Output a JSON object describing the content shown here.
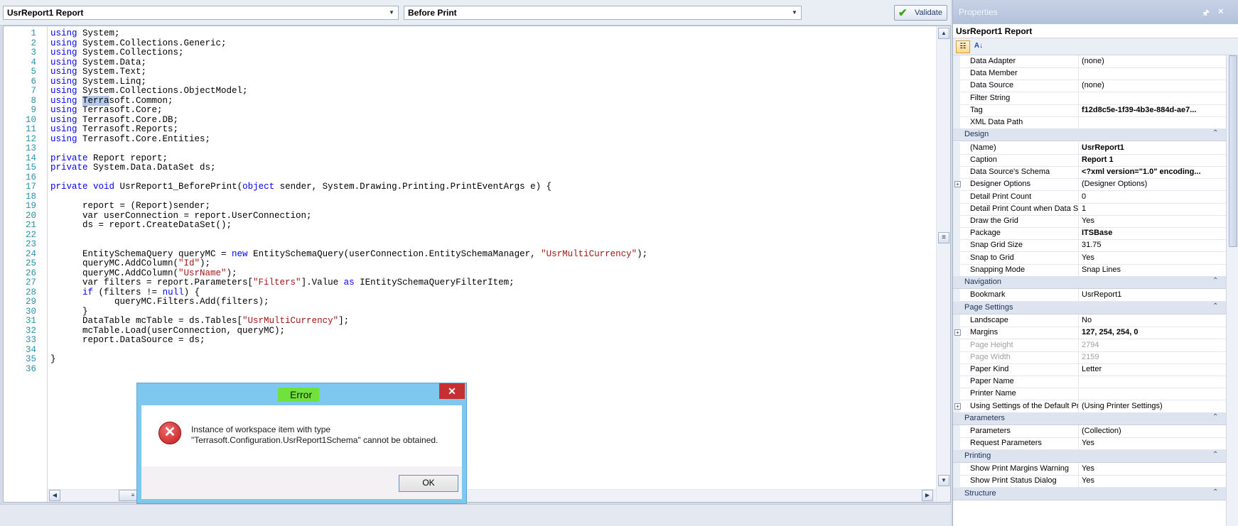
{
  "toolbar": {
    "object_combo": "UsrReport1  Report",
    "event_combo": "Before Print",
    "validate_label": "Validate"
  },
  "code_lines": [
    [
      {
        "t": "using",
        "k": "kw"
      },
      {
        "t": " System;"
      }
    ],
    [
      {
        "t": "using",
        "k": "kw"
      },
      {
        "t": " System.Collections.Generic;"
      }
    ],
    [
      {
        "t": "using",
        "k": "kw"
      },
      {
        "t": " System.Collections;"
      }
    ],
    [
      {
        "t": "using",
        "k": "kw"
      },
      {
        "t": " System.Data;"
      }
    ],
    [
      {
        "t": "using",
        "k": "kw"
      },
      {
        "t": " System.Text;"
      }
    ],
    [
      {
        "t": "using",
        "k": "kw"
      },
      {
        "t": " System.Linq;"
      }
    ],
    [
      {
        "t": "using",
        "k": "kw"
      },
      {
        "t": " System.Collections.ObjectModel;"
      }
    ],
    [
      {
        "t": "using",
        "k": "kw"
      },
      {
        "t": " "
      },
      {
        "t": "Terra",
        "k": "sel"
      },
      {
        "t": "soft.Common;"
      }
    ],
    [
      {
        "t": "using",
        "k": "kw"
      },
      {
        "t": " Terrasoft.Core;"
      }
    ],
    [
      {
        "t": "using",
        "k": "kw"
      },
      {
        "t": " Terrasoft.Core.DB;"
      }
    ],
    [
      {
        "t": "using",
        "k": "kw"
      },
      {
        "t": " Terrasoft.Reports;"
      }
    ],
    [
      {
        "t": "using",
        "k": "kw"
      },
      {
        "t": " Terrasoft.Core.Entities;"
      }
    ],
    [],
    [
      {
        "t": "private",
        "k": "kw"
      },
      {
        "t": " Report report;"
      }
    ],
    [
      {
        "t": "private",
        "k": "kw"
      },
      {
        "t": " System.Data.DataSet ds;"
      }
    ],
    [],
    [
      {
        "t": "private",
        "k": "kw"
      },
      {
        "t": " "
      },
      {
        "t": "void",
        "k": "kw"
      },
      {
        "t": " UsrReport1_BeforePrint("
      },
      {
        "t": "object",
        "k": "kw"
      },
      {
        "t": " sender, System.Drawing.Printing.PrintEventArgs e) {"
      }
    ],
    [],
    [
      {
        "t": "      report = (Report)sender;"
      }
    ],
    [
      {
        "t": "      var userConnection = report.UserConnection;"
      }
    ],
    [
      {
        "t": "      ds = report.CreateDataSet();"
      }
    ],
    [],
    [],
    [
      {
        "t": "      EntitySchemaQuery queryMC = "
      },
      {
        "t": "new",
        "k": "kw"
      },
      {
        "t": " EntitySchemaQuery(userConnection.EntitySchemaManager, "
      },
      {
        "t": "\"UsrMultiCurrency\"",
        "k": "str"
      },
      {
        "t": ");"
      }
    ],
    [
      {
        "t": "      queryMC.AddColumn("
      },
      {
        "t": "\"Id\"",
        "k": "str"
      },
      {
        "t": ");"
      }
    ],
    [
      {
        "t": "      queryMC.AddColumn("
      },
      {
        "t": "\"UsrName\"",
        "k": "str"
      },
      {
        "t": ");"
      }
    ],
    [
      {
        "t": "      var filters = report.Parameters["
      },
      {
        "t": "\"Filters\"",
        "k": "str"
      },
      {
        "t": "].Value "
      },
      {
        "t": "as",
        "k": "kw"
      },
      {
        "t": " IEntitySchemaQueryFilterItem;"
      }
    ],
    [
      {
        "t": "      "
      },
      {
        "t": "if",
        "k": "kw"
      },
      {
        "t": " (filters != "
      },
      {
        "t": "null",
        "k": "kw"
      },
      {
        "t": ") {"
      }
    ],
    [
      {
        "t": "            queryMC.Filters.Add(filters);"
      }
    ],
    [
      {
        "t": "      }"
      }
    ],
    [
      {
        "t": "      DataTable mcTable = ds.Tables["
      },
      {
        "t": "\"UsrMultiCurrency\"",
        "k": "str"
      },
      {
        "t": "];"
      }
    ],
    [
      {
        "t": "      mcTable.Load(userConnection, queryMC);"
      }
    ],
    [
      {
        "t": "      report.DataSource = ds;"
      }
    ],
    [],
    [
      {
        "t": "}"
      }
    ],
    []
  ],
  "properties_panel": {
    "title": "Properties",
    "selected_object": "UsrReport1  Report",
    "rows": [
      {
        "type": "prop",
        "name": "Data Adapter",
        "value": "(none)"
      },
      {
        "type": "prop",
        "name": "Data Member",
        "value": ""
      },
      {
        "type": "prop",
        "name": "Data Source",
        "value": "(none)"
      },
      {
        "type": "prop",
        "name": "Filter String",
        "value": ""
      },
      {
        "type": "prop",
        "name": "Tag",
        "value": "f12d8c5e-1f39-4b3e-884d-ae7...",
        "bold": true
      },
      {
        "type": "prop",
        "name": "XML Data Path",
        "value": ""
      },
      {
        "type": "cat",
        "name": "Design"
      },
      {
        "type": "prop",
        "name": "(Name)",
        "value": "UsrReport1",
        "bold": true
      },
      {
        "type": "prop",
        "name": "Caption",
        "value": "Report 1",
        "bold": true
      },
      {
        "type": "prop",
        "name": "Data Source's Schema",
        "value": "<?xml version=\"1.0\" encoding...",
        "bold": true
      },
      {
        "type": "prop",
        "name": "Designer Options",
        "value": "(Designer Options)",
        "expand": true
      },
      {
        "type": "prop",
        "name": "Detail Print Count",
        "value": "0"
      },
      {
        "type": "prop",
        "name": "Detail Print Count when Data Sour",
        "value": "1"
      },
      {
        "type": "prop",
        "name": "Draw the Grid",
        "value": "Yes"
      },
      {
        "type": "prop",
        "name": "Package",
        "value": "ITSBase",
        "bold": true
      },
      {
        "type": "prop",
        "name": "Snap Grid Size",
        "value": "31.75"
      },
      {
        "type": "prop",
        "name": "Snap to Grid",
        "value": "Yes"
      },
      {
        "type": "prop",
        "name": "Snapping Mode",
        "value": "Snap Lines"
      },
      {
        "type": "cat",
        "name": "Navigation"
      },
      {
        "type": "prop",
        "name": "Bookmark",
        "value": "UsrReport1"
      },
      {
        "type": "cat",
        "name": "Page Settings"
      },
      {
        "type": "prop",
        "name": "Landscape",
        "value": "No"
      },
      {
        "type": "prop",
        "name": "Margins",
        "value": "127, 254, 254, 0",
        "bold": true,
        "expand": true
      },
      {
        "type": "prop",
        "name": "Page Height",
        "value": "2794",
        "dim": true
      },
      {
        "type": "prop",
        "name": "Page Width",
        "value": "2159",
        "dim": true
      },
      {
        "type": "prop",
        "name": "Paper Kind",
        "value": "Letter"
      },
      {
        "type": "prop",
        "name": "Paper Name",
        "value": ""
      },
      {
        "type": "prop",
        "name": "Printer Name",
        "value": ""
      },
      {
        "type": "prop",
        "name": "Using Settings of the Default Print",
        "value": "(Using Printer Settings)",
        "expand": true
      },
      {
        "type": "cat",
        "name": "Parameters"
      },
      {
        "type": "prop",
        "name": "Parameters",
        "value": "(Collection)"
      },
      {
        "type": "prop",
        "name": "Request Parameters",
        "value": "Yes"
      },
      {
        "type": "cat",
        "name": "Printing"
      },
      {
        "type": "prop",
        "name": "Show Print Margins Warning",
        "value": "Yes"
      },
      {
        "type": "prop",
        "name": "Show Print Status Dialog",
        "value": "Yes"
      },
      {
        "type": "cat",
        "name": "Structure"
      }
    ]
  },
  "dialog": {
    "title": "Error",
    "close": "✕",
    "message_line1": "Instance of workspace item with type",
    "message_line2": "\"Terrasoft.Configuration.UsrReport1Schema\" cannot be obtained.",
    "ok_label": "OK"
  },
  "colors": {
    "keyword": "#0000ff",
    "string": "#a31515",
    "line_number": "#2b91af",
    "dialog_frame": "#7ec8f0",
    "title_highlight": "#6fe23c"
  }
}
